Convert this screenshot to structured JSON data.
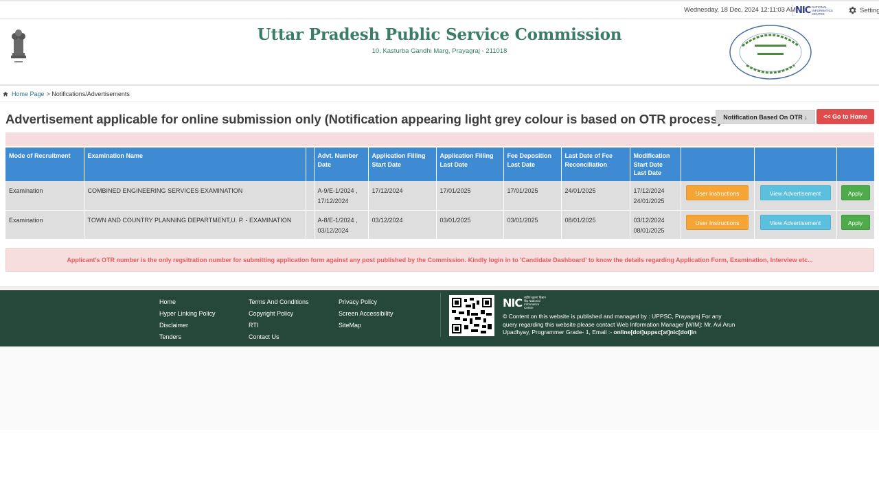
{
  "topbar": {
    "datetime": "Wednesday, 18 Dec, 2024 12:11:03 AM",
    "nic_word": "NIC",
    "nic_sub": "NATIONAL INFORMATICS CENTRE",
    "settings_label": "Settings"
  },
  "header": {
    "title": "Uttar Pradesh Public Service Commission",
    "address": "10, Kasturba Gandhi Marg, Prayagraj - 211018"
  },
  "breadcrumb": {
    "home": "Home Page",
    "current": "> Notifications/Advertisements"
  },
  "page": {
    "heading": "Advertisement applicable for online submission only (Notification appearing light grey colour is based on OTR process)",
    "otr_button": "Notification Based On OTR ↓",
    "home_button": "<< Go to Home"
  },
  "table": {
    "headers": [
      "Mode of Recruitment",
      "Examination Name",
      "",
      "Advt. Number Date",
      "Application Filling Start Date",
      "Application Filling Last Date",
      "Fee Deposition Last Date",
      "Last Date of Fee Reconciliation",
      "Modification Start Date Last Date",
      "",
      "",
      ""
    ],
    "rows": [
      {
        "mode": "Examination",
        "exam": "COMBINED ENGINEERING SERVICES EXAMINATION",
        "advt_number": "A-9/E-1/2024 ,",
        "advt_date": "17/12/2024",
        "start": "17/12/2024",
        "last": "17/01/2025",
        "fee_last": "17/01/2025",
        "reconciliation": "24/01/2025",
        "mod_start": "17/12/2024",
        "mod_last": "24/01/2025",
        "instructions": "User Instructions",
        "view": "View Advertisement",
        "apply": "Apply"
      },
      {
        "mode": "Examination",
        "exam": "TOWN AND COUNTRY PLANNING DEPARTMENT,U. P. - EXAMINATION",
        "advt_number": "A-8/E-1/2024 ,",
        "advt_date": "03/12/2024",
        "start": "03/12/2024",
        "last": "03/01/2025",
        "fee_last": "03/01/2025",
        "reconciliation": "08/01/2025",
        "mod_start": "03/12/2024",
        "mod_last": "08/01/2025",
        "instructions": "User Instructions",
        "view": "View Advertisement",
        "apply": "Apply"
      }
    ]
  },
  "notice": "Applicant's OTR number is the only regsitration number for submitting application form against any post published by the Commission. Kindly login in to 'Candidate Dashboard' to know the details regarding Application Form, Examination, Interview etc...",
  "footer": {
    "col1": [
      "Home",
      "Hyper Linking Policy",
      "Disclaimer",
      "Tenders"
    ],
    "col2": [
      "Terms And Conditions",
      "Copyright Policy",
      "RTI",
      "Contact Us"
    ],
    "col3": [
      "Privacy Policy",
      "Screen Accessibility",
      "SiteMap"
    ],
    "nic_word": "NIC",
    "nic_sub": "राष्ट्रीय सूचना विज्ञान केंद्र National Informatics Centre",
    "text": "© Content on this website is published and managed by : UPPSC, Prayagraj For any query regarding this website please contact Web Information Manager [WIM]: Mr. Avi Arun Upadhyay, Programmer Grade- 1, Email :-",
    "email": "online[dot]uppsc[at]nic[dot]in"
  },
  "colors": {
    "title_green": "#3b7d6a",
    "table_header_blue": "#3e8bd4",
    "footer_green": "#26483a",
    "home_red": "#e04b4b",
    "instructions_orange": "#f4a535",
    "view_cyan": "#5bc0de",
    "apply_green": "#4dac49"
  }
}
